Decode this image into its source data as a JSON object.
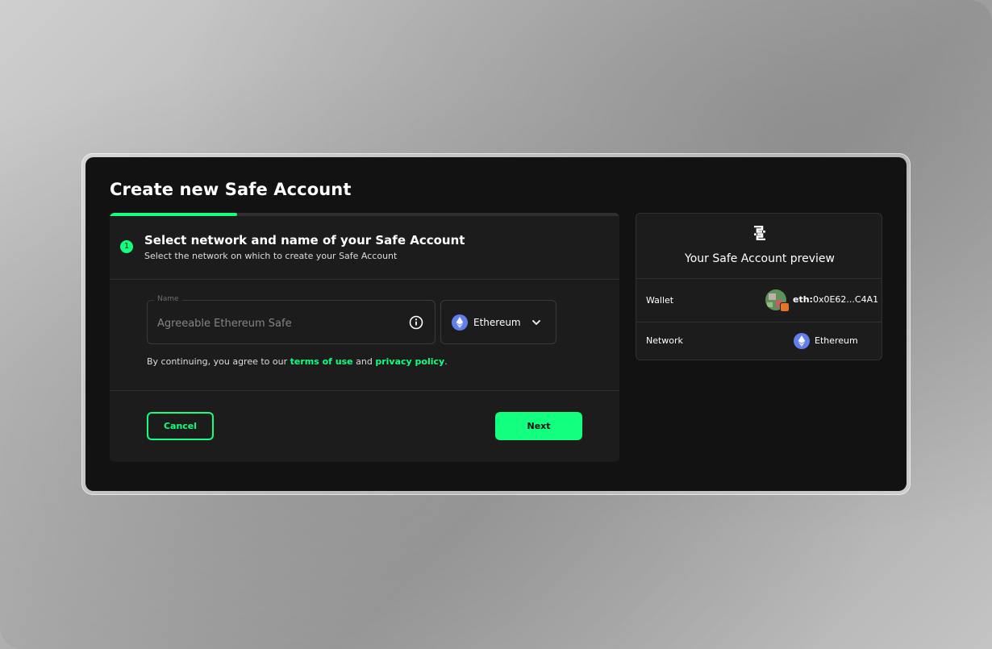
{
  "page": {
    "title": "Create new Safe Account"
  },
  "progress": {
    "fraction": 0.25
  },
  "step": {
    "number": "1",
    "title": "Select network and name of your Safe Account",
    "subtitle": "Select the network on which to create your Safe Account"
  },
  "form": {
    "name_label": "Name",
    "name_placeholder": "Agreeable Ethereum Safe",
    "name_value": "",
    "info_icon": "info-circle-icon",
    "network": {
      "selected": "Ethereum",
      "icon": "ethereum-icon",
      "chevron_icon": "chevron-down-icon"
    },
    "terms": {
      "prefix": "By continuing, you agree to our ",
      "terms_link": "terms of use",
      "middle": " and ",
      "privacy_link": "privacy policy",
      "suffix": "."
    }
  },
  "actions": {
    "cancel_label": "Cancel",
    "next_label": "Next"
  },
  "preview": {
    "logo_icon": "safe-logo-icon",
    "title": "Your Safe Account preview",
    "wallet_label": "Wallet",
    "wallet_prefix": "eth:",
    "wallet_address": "0x0E62...C4A1",
    "network_label": "Network",
    "network_value": "Ethereum"
  },
  "colors": {
    "accent": "#12ff80",
    "window_bg": "#121212",
    "card_bg": "#1c1c1c",
    "ethereum": "#627eea"
  }
}
